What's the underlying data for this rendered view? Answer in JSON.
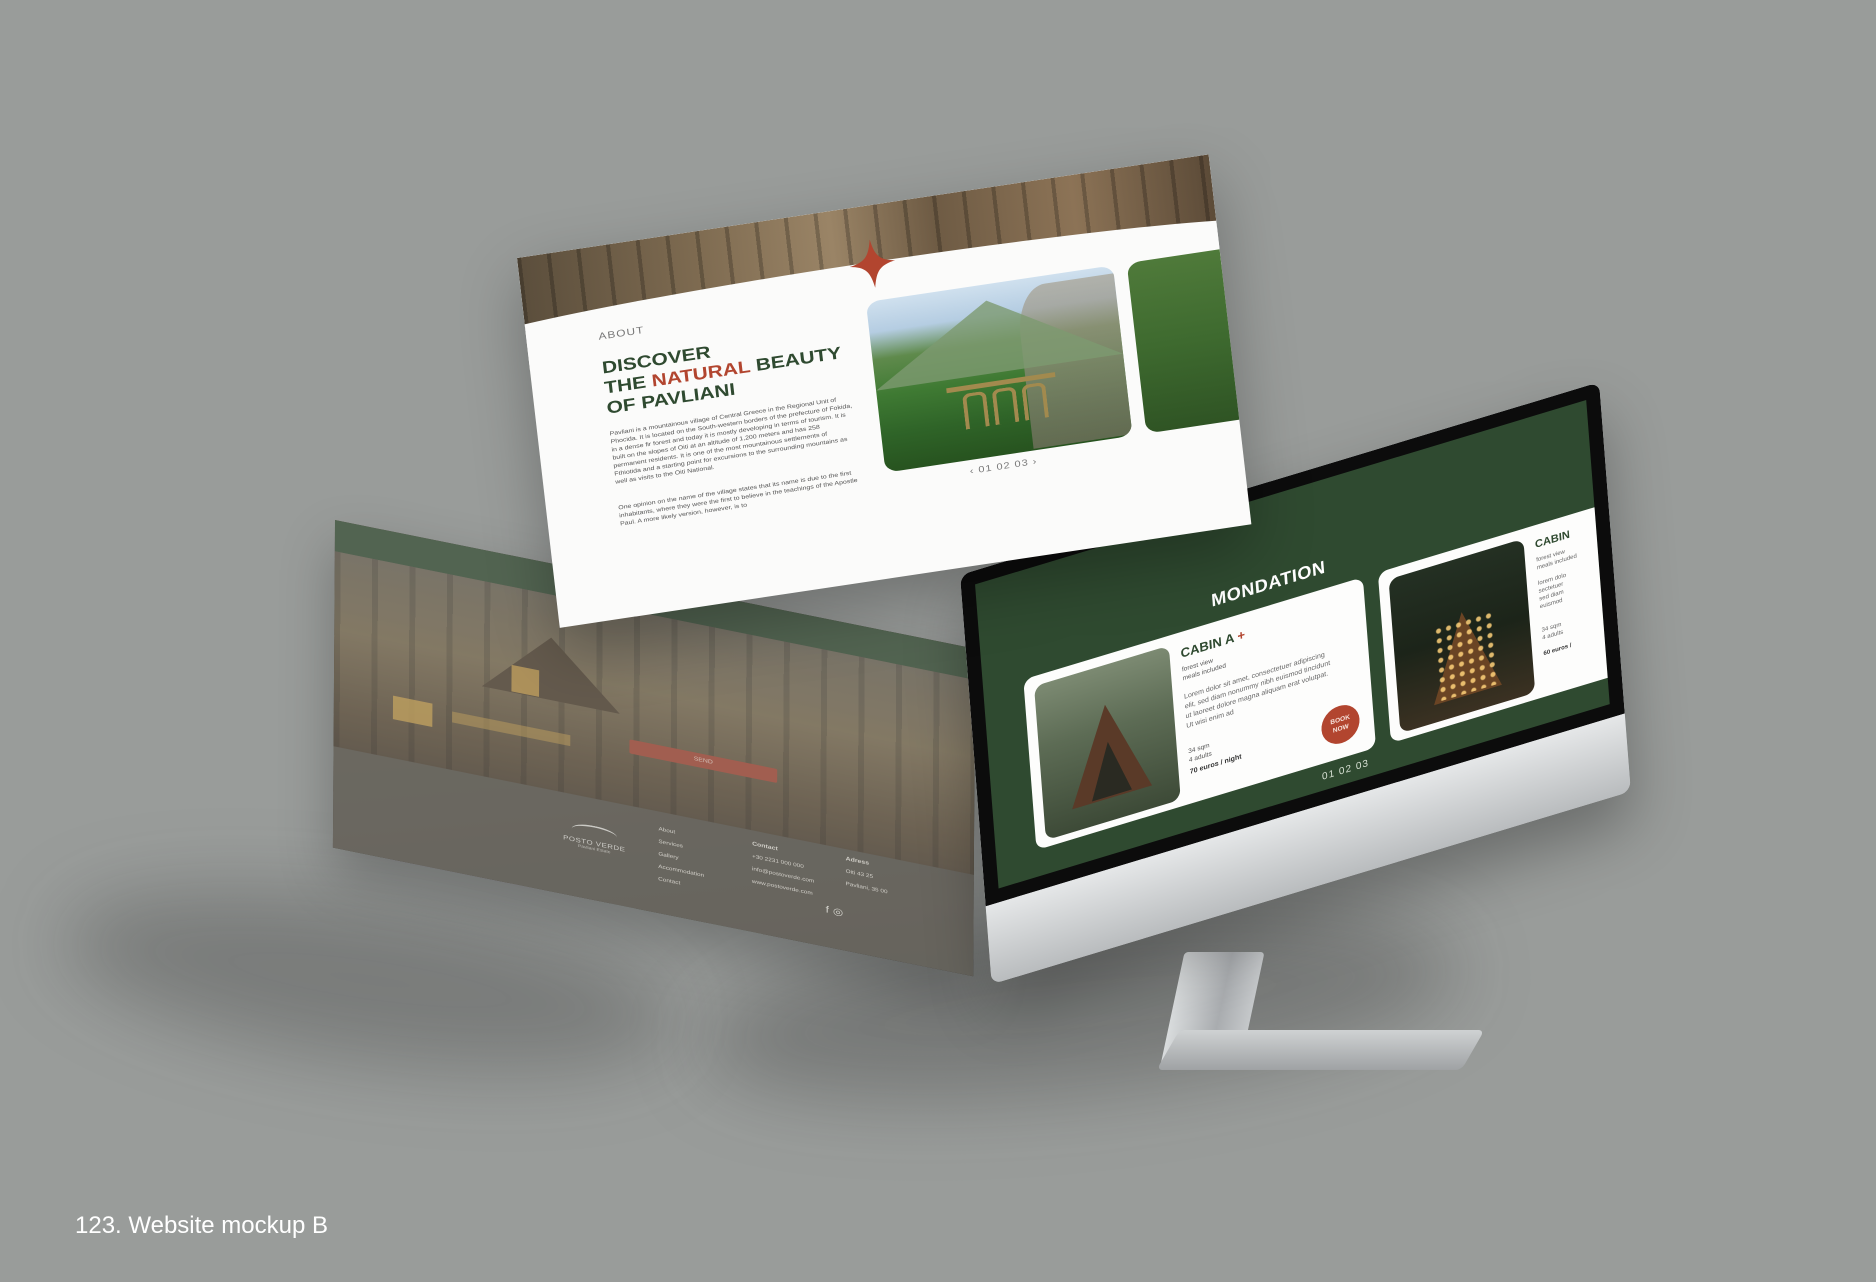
{
  "caption": "123. Website mockup B",
  "colors": {
    "background": "#999c9a",
    "brand_green": "#2f4a30",
    "accent_red": "#b2452f",
    "page_white": "#fbfbfa"
  },
  "about_page": {
    "section_label": "ABOUT",
    "headline_line1": "DISCOVER",
    "headline_line2_pre": "THE",
    "headline_line2_accent": "NATURAL",
    "headline_line2_post": "BEAUTY",
    "headline_line3": "OF PAVLIANI",
    "paragraph1": "Pavliani is a mountainous village of Central Greece in the Regional Unit of Phocida. It is located on the South-western borders of the prefecture of Fokida, in a dense fir forest and today it is mostly developing in terms of tourism. It is built on the slopes of Oiti at an altitude of 1,200 meters and has 258 permanent residents. It is one of the most mountainous settlements of Fthiotida and a starting point for excursions to the surrounding mountains as well as visits to the Oiti National.",
    "paragraph2": "One opinion on the name of the village states that its name is due to the first inhabitants, where they were the first to believe in the teachings of the Apostle Paul. A more likely version, however, is to",
    "pager": "‹ 01 02 03 ›",
    "star_icon": "four-point-star-icon",
    "images": [
      "valley-bridge-photo",
      "forest-photo"
    ]
  },
  "footer_page": {
    "button_label": "SEND",
    "logo_name": "POSTO VERDE",
    "logo_sub": "Pavliani Estate",
    "links": [
      "About",
      "Services",
      "Gallery",
      "Accommodation",
      "Contact"
    ],
    "contact_heading": "Contact",
    "contact_lines": [
      "+30 2231 000 000",
      "info@postoverde.com",
      "www.postoverde.com"
    ],
    "address_heading": "Adress",
    "address_lines": [
      "Oiti 43 25",
      "Pavliani, 35 00"
    ],
    "social_icons": [
      "facebook-icon",
      "instagram-icon"
    ]
  },
  "monitor": {
    "section_title": "MONDATION",
    "cabin_a": {
      "name": "CABIN A",
      "plus": "+",
      "line1": "forest view",
      "line2": "meals included",
      "description": "Lorem dolor sit amet, consectetuer adipiscing elit, sed diam nonummy nibh euismod tincidunt ut laoreet dolore magna aliquam erat volutpat. Ut wisi enim ad",
      "size": "34 sqm",
      "guests": "4 adults",
      "price": "70 euros / night",
      "book_label_1": "BOOK",
      "book_label_2": "NOW"
    },
    "cabin_b": {
      "name": "CABIN",
      "line1": "forest view",
      "line2": "meals included",
      "desc1": "lorem dolo",
      "desc2": "sectetuer",
      "desc3": "sed diam",
      "desc4": "euismod",
      "size": "34 sqm",
      "guests": "4 adults",
      "price": "60 euros /"
    },
    "pager": "01 02 03"
  }
}
